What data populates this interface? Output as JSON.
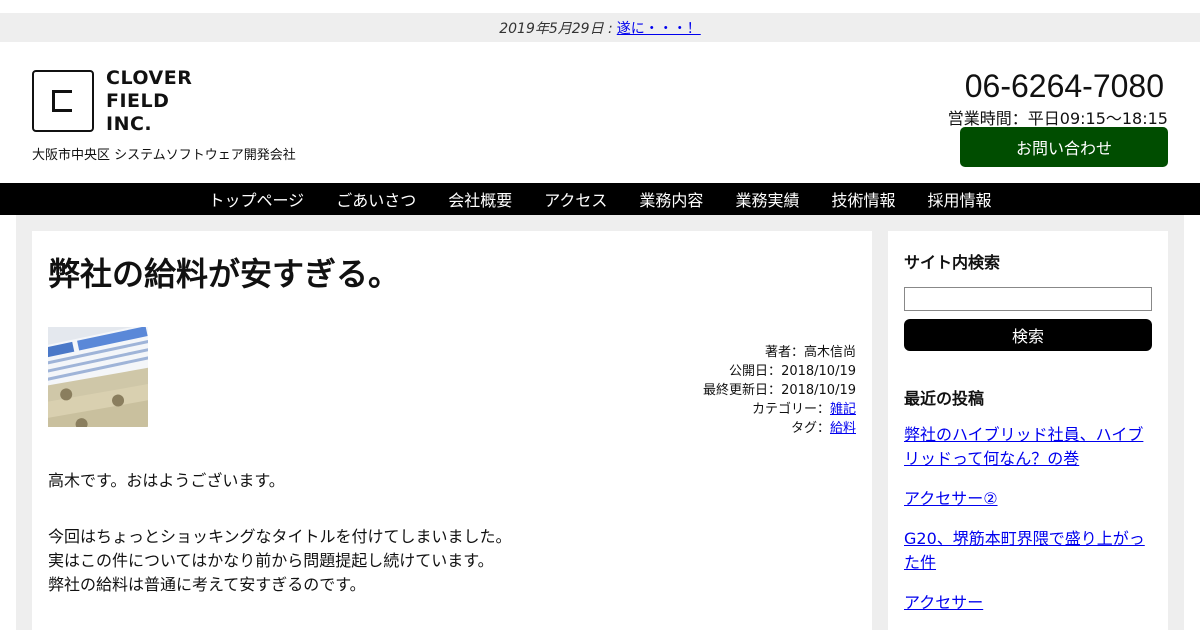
{
  "notice": {
    "date": "2019年5月29日 :",
    "link": "遂に・・・！"
  },
  "header": {
    "logo_lines": [
      "CLOVER",
      "FIELD",
      "INC."
    ],
    "tagline": "大阪市中央区 システムソフトウェア開発会社",
    "phone": "06-6264-7080",
    "hours": "営業時間：平日09:15〜18:15",
    "contact_button": "お問い合わせ"
  },
  "nav": {
    "items": [
      "トップページ",
      "ごあいさつ",
      "会社概要",
      "アクセス",
      "業務内容",
      "業務実績",
      "技術情報",
      "採用情報"
    ]
  },
  "article": {
    "title": "弊社の給料が安すぎる。",
    "meta": {
      "author_label": "著者：",
      "author": "高木信尚",
      "published_label": "公開日：",
      "published": "2018/10/19",
      "updated_label": "最終更新日：",
      "updated": "2018/10/19",
      "category_label": "カテゴリー：",
      "category": "雑記",
      "tag_label": "タグ：",
      "tag": "給料"
    },
    "paragraphs": [
      [
        "高木です。おはようございます。"
      ],
      [
        "今回はちょっとショッキングなタイトルを付けてしまいました。",
        "実はこの件についてはかなり前から問題提起し続けています。",
        "弊社の給料は普通に考えて安すぎるのです。"
      ]
    ]
  },
  "sidebar": {
    "search_heading": "サイト内検索",
    "search_value": "",
    "search_button": "検索",
    "recent_heading": "最近の投稿",
    "recent_posts": [
      "弊社のハイブリッド社員、ハイブリッドって何なん？の巻",
      "アクセサー②",
      "G20、堺筋本町界隈で盛り上がった件",
      "アクセサー"
    ]
  },
  "colors": {
    "nav_bg": "#000000",
    "contact_bg": "#004d00",
    "link": "#0000ee",
    "page_bg": "#eeeeee"
  }
}
